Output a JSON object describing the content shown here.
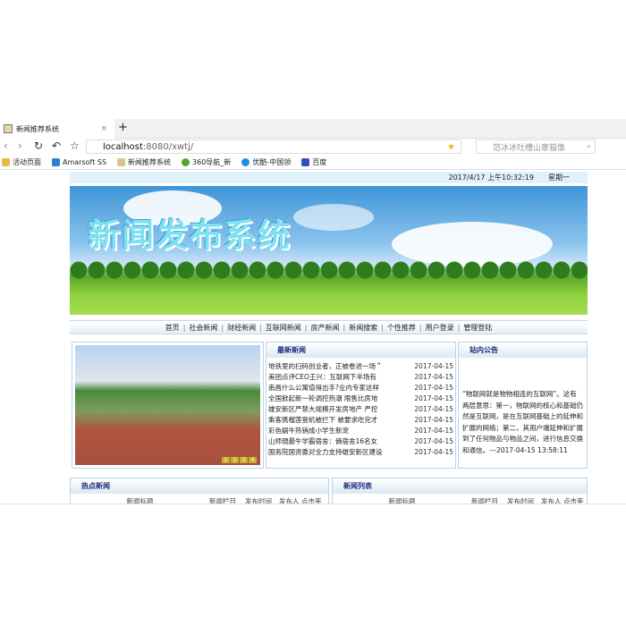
{
  "browser": {
    "tab_title": "新闻推荐系统",
    "new_tab": "+",
    "close": "×",
    "url_host": "localhost",
    "url_path": ":8080/xwtj/",
    "search_placeholder": "范冰冰吐槽山寨猫像",
    "bookmarks": [
      {
        "label": "活动页面",
        "color": "#e8b84a"
      },
      {
        "label": "Amarsoft SS",
        "color": "#2a7fd6"
      },
      {
        "label": "新闻推荐系统",
        "color": "#d8c48a"
      },
      {
        "label": "360导航_新",
        "color": "#4aa82a"
      },
      {
        "label": "优酷-中国领",
        "color": "#1f8ee0"
      },
      {
        "label": "百度",
        "color": "#3050c8"
      }
    ]
  },
  "page": {
    "date": "2017/4/17 上午10:32:19",
    "weekday": "星期一",
    "banner_title": "新闻发布系统",
    "menu": [
      "首页",
      "社会新闻",
      "财经新闻",
      "互联网新闻",
      "房产新闻",
      "新闻搜索",
      "个性推荐",
      "用户登录",
      "管理登陆"
    ],
    "slider_pages": [
      "1",
      "2",
      "3",
      "4"
    ],
    "latest": {
      "title": "最新新闻",
      "items": [
        {
          "t": "地铁里的扫码创业者，正被卷进一场＂",
          "d": "2017-04-15"
        },
        {
          "t": "美团点评CEO王兴：互联网下半场有",
          "d": "2017-04-15"
        },
        {
          "t": "南昌什么公寓值得出手?业内专家这样",
          "d": "2017-04-15"
        },
        {
          "t": "全国掀起新一轮调控热潮 限售比房地",
          "d": "2017-04-15"
        },
        {
          "t": "雄安新区严禁大规模开发房地产 严控",
          "d": "2017-04-15"
        },
        {
          "t": "乘客携榴莲登机被拦下 被要求吃完才",
          "d": "2017-04-15"
        },
        {
          "t": "彩色蜗牛热销成小学生新宠",
          "d": "2017-04-15"
        },
        {
          "t": "山师現最牛学霸宿舍：俩宿舍16名女",
          "d": "2017-04-15"
        },
        {
          "t": "国务院国资委对全力支持雄安新区建设",
          "d": "2017-04-15"
        }
      ]
    },
    "notice": {
      "title": "站内公告",
      "text": "“物联网就是物物相连的互联网”。这有两层意思：第一，物联网的核心和基础仍然是互联网，是在互联网基础上的延伸和扩展的网络；第二，其用户端延伸和扩展到了任何物品与物品之间，进行信息交换和通信。---2017-04-15 13:58:11"
    },
    "hot": {
      "title": "热点新闻",
      "cols": [
        "新闻标题",
        "新闻栏目",
        "发布时间",
        "发布人",
        "点击率"
      ]
    },
    "newslist": {
      "title": "新闻列表",
      "cols": [
        "新闻标题",
        "新闻栏目",
        "发布时间",
        "发布人",
        "点击率"
      ]
    }
  }
}
